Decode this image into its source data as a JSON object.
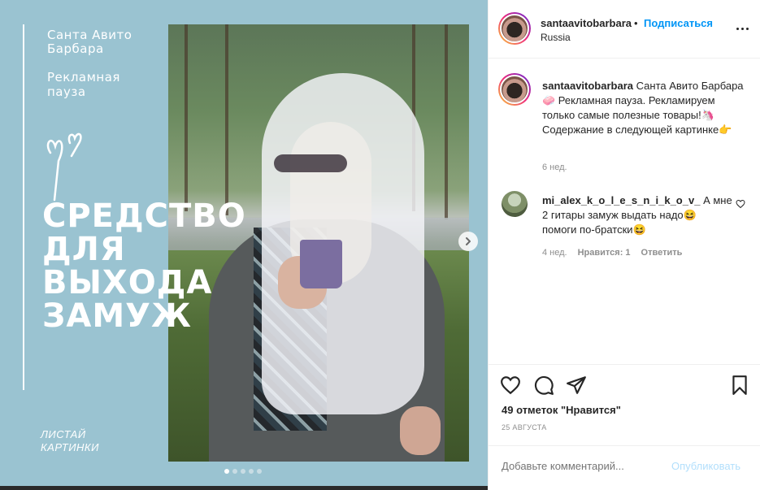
{
  "media": {
    "name_line1": "Санта Авито",
    "name_line2": "Барбара",
    "pause_line1": "Рекламная",
    "pause_line2": "пауза",
    "headline": [
      "средство",
      "для",
      "выхода",
      "замуж"
    ],
    "swipe_line1": "ЛИСТАЙ",
    "swipe_line2": "КАРТИНКИ",
    "carousel_dots": 5,
    "active_dot": 0,
    "next_icon": "chevron-right-icon",
    "background_color": "#9ac3d1"
  },
  "post": {
    "username": "santaavitobarbara",
    "separator": "•",
    "follow_label": "Подписаться",
    "location": "Russia",
    "more_icon": "more-horizontal-icon"
  },
  "caption": {
    "username": "santaavitobarbara",
    "text": "Санта Авито Барбара🧼 Рекламная пауза. Рекламируем только самые полезные товары!🦄 Содержание в следующей картинке👉",
    "time": "6 нед."
  },
  "comment": {
    "username": "mi_alex_k_o_l_e_s_n_i_k_o_v_",
    "text": "А мне 2 гитары замуж выдать надо😆 помоги по-братски😆",
    "time": "4 нед.",
    "likes": "Нравится: 1",
    "reply": "Ответить"
  },
  "actions": {
    "likes_text": "49 отметок \"Нравится\"",
    "date": "25 АВГУСТА"
  },
  "add_comment": {
    "placeholder": "Добавьте комментарий...",
    "publish_label": "Опубликовать"
  },
  "colors": {
    "accent": "#0095f6",
    "publish_disabled": "#b2dffc",
    "muted": "#8e8e8e"
  }
}
